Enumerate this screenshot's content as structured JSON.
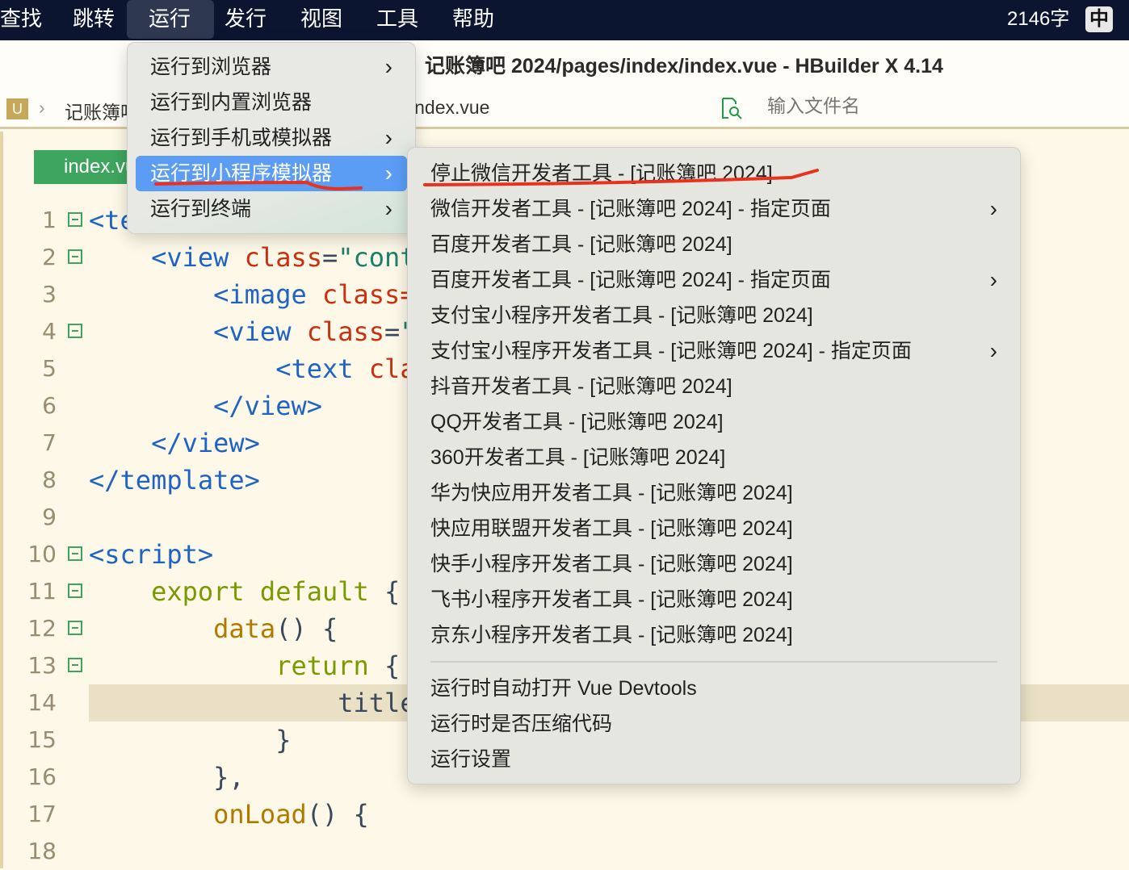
{
  "menubar": {
    "items": [
      "查找",
      "跳转",
      "运行",
      "发行",
      "视图",
      "工具",
      "帮助"
    ],
    "word_count": "2146字",
    "ime": "中"
  },
  "window_title": "记账簿吧 2024/pages/index/index.vue - HBuilder X 4.14",
  "breadcrumb": {
    "project_icon": "U",
    "project": "记账簿吧",
    "file": "index.vue",
    "search_placeholder": "输入文件名"
  },
  "editor": {
    "tab": "index.vue",
    "lines": [
      {
        "n": "1",
        "fold": true,
        "tokens": [
          [
            "t-tag",
            "<te"
          ]
        ]
      },
      {
        "n": "2",
        "fold": true,
        "tokens": [
          [
            "t-p",
            "    "
          ],
          [
            "t-tag",
            "<view "
          ],
          [
            "t-attr",
            "class"
          ],
          [
            "t-p",
            "="
          ],
          [
            "t-str",
            "\"cont"
          ]
        ]
      },
      {
        "n": "3",
        "tokens": [
          [
            "t-p",
            "        "
          ],
          [
            "t-tag",
            "<image "
          ],
          [
            "t-attr",
            "class="
          ]
        ]
      },
      {
        "n": "4",
        "fold": true,
        "tokens": [
          [
            "t-p",
            "        "
          ],
          [
            "t-tag",
            "<view "
          ],
          [
            "t-attr",
            "class"
          ],
          [
            "t-p",
            "="
          ],
          [
            "t-str",
            "\""
          ]
        ]
      },
      {
        "n": "5",
        "tokens": [
          [
            "t-p",
            "            "
          ],
          [
            "t-tag",
            "<text "
          ],
          [
            "t-attr",
            "cla"
          ]
        ]
      },
      {
        "n": "6",
        "tokens": [
          [
            "t-p",
            "        "
          ],
          [
            "t-tag",
            "</view>"
          ]
        ]
      },
      {
        "n": "7",
        "tokens": [
          [
            "t-p",
            "    "
          ],
          [
            "t-tag",
            "</view>"
          ]
        ]
      },
      {
        "n": "8",
        "tokens": [
          [
            "t-tag",
            "</template>"
          ]
        ]
      },
      {
        "n": "9",
        "tokens": []
      },
      {
        "n": "10",
        "fold": true,
        "tokens": [
          [
            "t-tag",
            "<script>"
          ]
        ]
      },
      {
        "n": "11",
        "fold": true,
        "tokens": [
          [
            "t-p",
            "    "
          ],
          [
            "t-kw",
            "export default "
          ],
          [
            "t-p",
            "{"
          ]
        ]
      },
      {
        "n": "12",
        "fold": true,
        "tokens": [
          [
            "t-p",
            "        "
          ],
          [
            "t-fn",
            "data"
          ],
          [
            "t-p",
            "() {"
          ]
        ]
      },
      {
        "n": "13",
        "fold": true,
        "tokens": [
          [
            "t-p",
            "            "
          ],
          [
            "t-kw",
            "return "
          ],
          [
            "t-p",
            "{"
          ]
        ]
      },
      {
        "n": "14",
        "hl": true,
        "tokens": [
          [
            "t-p",
            "                title"
          ]
        ]
      },
      {
        "n": "15",
        "tokens": [
          [
            "t-p",
            "            }"
          ]
        ]
      },
      {
        "n": "16",
        "tokens": [
          [
            "t-p",
            "        },"
          ]
        ]
      },
      {
        "n": "17",
        "tokens": [
          [
            "t-p",
            "        "
          ],
          [
            "t-fn",
            "onLoad"
          ],
          [
            "t-p",
            "() {"
          ]
        ]
      },
      {
        "n": "18",
        "tokens": []
      }
    ]
  },
  "run_menu": [
    {
      "label": "运行到浏览器",
      "arrow": true
    },
    {
      "label": "运行到内置浏览器",
      "arrow": false
    },
    {
      "label": "运行到手机或模拟器",
      "arrow": true
    },
    {
      "label": "运行到小程序模拟器",
      "arrow": true,
      "selected": true
    },
    {
      "label": "运行到终端",
      "arrow": true
    }
  ],
  "submenu": {
    "items": [
      {
        "label": "停止微信开发者工具 - [记账簿吧 2024]"
      },
      {
        "label": "微信开发者工具 - [记账簿吧 2024] - 指定页面",
        "arrow": true
      },
      {
        "label": "百度开发者工具 - [记账簿吧 2024]"
      },
      {
        "label": "百度开发者工具 - [记账簿吧 2024] - 指定页面",
        "arrow": true
      },
      {
        "label": "支付宝小程序开发者工具 - [记账簿吧 2024]"
      },
      {
        "label": "支付宝小程序开发者工具 - [记账簿吧 2024] - 指定页面",
        "arrow": true
      },
      {
        "label": "抖音开发者工具 - [记账簿吧 2024]"
      },
      {
        "label": "QQ开发者工具 - [记账簿吧 2024]"
      },
      {
        "label": "360开发者工具 - [记账簿吧 2024]"
      },
      {
        "label": "华为快应用开发者工具 - [记账簿吧 2024]"
      },
      {
        "label": "快应用联盟开发者工具 - [记账簿吧 2024]"
      },
      {
        "label": "快手小程序开发者工具 - [记账簿吧 2024]"
      },
      {
        "label": "飞书小程序开发者工具 - [记账簿吧 2024]"
      },
      {
        "label": "京东小程序开发者工具 - [记账簿吧 2024]"
      }
    ],
    "extra": [
      "运行时自动打开 Vue Devtools",
      "运行时是否压缩代码",
      "运行设置"
    ]
  },
  "colors": {
    "menubar": "#0b1530",
    "selection": "#5b9cf5",
    "annotation": "#e8321e"
  }
}
